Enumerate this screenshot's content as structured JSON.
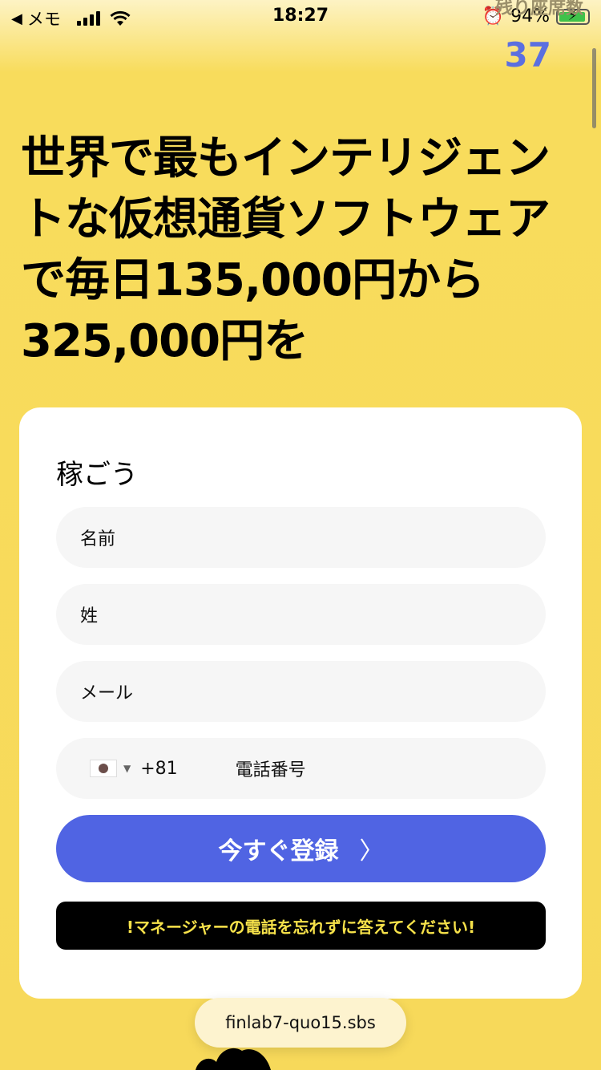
{
  "status_bar": {
    "back_app": "メモ",
    "time": "18:27",
    "battery_percent": "94%",
    "battery_level": 0.94
  },
  "counter": {
    "label": "残り座席数",
    "value": "37"
  },
  "headline": "世界で最もインテリジェントな仮想通貨ソフトウェアで毎日135,000円から325,000円を",
  "form": {
    "title": "稼ごう",
    "first_name_placeholder": "名前",
    "last_name_placeholder": "姓",
    "email_placeholder": "メール",
    "country_code": "+81",
    "phone_placeholder": "電話番号",
    "submit_label": "今すぐ登録",
    "notice": "!マネージャーの電話を忘れずに答えてください!"
  },
  "browser": {
    "url": "finlab7-quo15.sbs"
  },
  "colors": {
    "background": "#f7d95a",
    "button": "#5064e3",
    "counter": "#5b6fe0",
    "notice_text": "#f7e24a"
  }
}
